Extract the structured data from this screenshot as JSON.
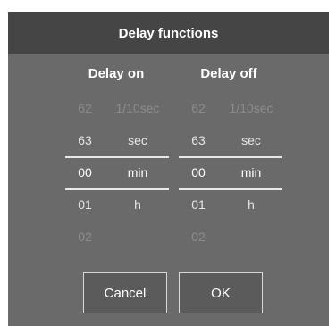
{
  "dialog": {
    "title": "Delay functions",
    "cancel_label": "Cancel",
    "ok_label": "OK"
  },
  "delay_on": {
    "header": "Delay on",
    "rows": [
      {
        "num": "62",
        "unit": "1/10sec"
      },
      {
        "num": "63",
        "unit": "sec"
      },
      {
        "num": "00",
        "unit": "min"
      },
      {
        "num": "01",
        "unit": "h"
      },
      {
        "num": "02",
        "unit": ""
      }
    ],
    "selected_index": 2
  },
  "delay_off": {
    "header": "Delay off",
    "rows": [
      {
        "num": "62",
        "unit": "1/10sec"
      },
      {
        "num": "63",
        "unit": "sec"
      },
      {
        "num": "00",
        "unit": "min"
      },
      {
        "num": "01",
        "unit": "h"
      },
      {
        "num": "02",
        "unit": ""
      }
    ],
    "selected_index": 2
  }
}
